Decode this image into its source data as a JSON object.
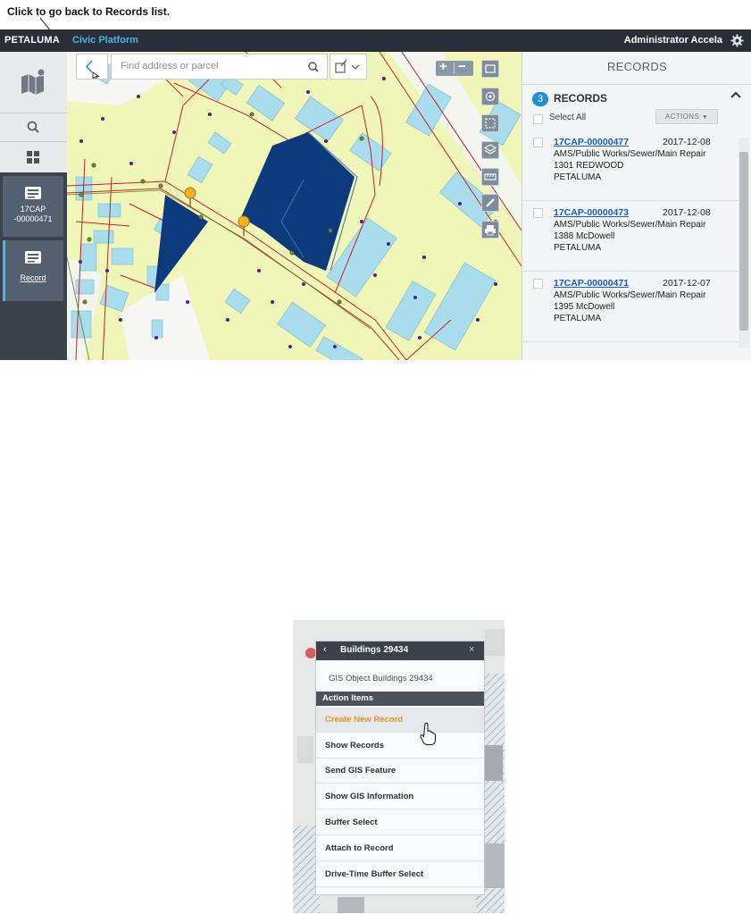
{
  "callout": {
    "text": "Click to go back to Records list."
  },
  "topbar": {
    "brand": "PETALUMA",
    "product": "Civic Platform",
    "user": "Administrator Accela",
    "settings_icon": "gear-icon"
  },
  "rail": {
    "items": [
      {
        "icon": "map-icon"
      },
      {
        "icon": "search-icon"
      },
      {
        "icon": "grid-icon"
      },
      {
        "icon": "record-icon",
        "label_line1": "17CAP",
        "label_line2": "-00000471"
      },
      {
        "icon": "record-icon",
        "label": "Record"
      }
    ]
  },
  "map": {
    "search_placeholder": "Find address or parcel",
    "zoom_in": "+",
    "zoom_out": "−"
  },
  "records_panel": {
    "header": "RECORDS",
    "count": "3",
    "title": "RECORDS",
    "select_all": "Select All",
    "actions": "ACTIONS",
    "records": [
      {
        "id": "17CAP-00000477",
        "date": "2017-12-08",
        "type": "AMS/Public Works/Sewer/Main Repair",
        "address": "1301 REDWOOD",
        "city": "PETALUMA"
      },
      {
        "id": "17CAP-00000473",
        "date": "2017-12-08",
        "type": "AMS/Public Works/Sewer/Main Repair",
        "address": "1388 McDowell",
        "city": "PETALUMA"
      },
      {
        "id": "17CAP-00000471",
        "date": "2017-12-07",
        "type": "AMS/Public Works/Sewer/Main Repair",
        "address": "1395 McDowell",
        "city": "PETALUMA"
      }
    ]
  },
  "popup": {
    "title": "Buildings 29434",
    "close": "×",
    "subtitle": "GIS Object Buildings 29434",
    "section": "Action Items",
    "items": [
      "Create New Record",
      "Show Records",
      "Send GIS Feature",
      "Show GIS Information",
      "Buffer Select",
      "Attach to Record",
      "Drive-Time Buffer Select"
    ],
    "highlight_color": "#f29420"
  },
  "colors": {
    "topbar": "#2a2f37",
    "accent": "#4bb4e6",
    "link": "#1a5fb4",
    "map_land": "#f0f5b8",
    "building": "#a9dcec",
    "selected_parcel": "#0d3a7c"
  }
}
